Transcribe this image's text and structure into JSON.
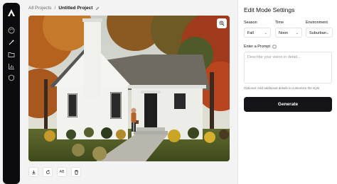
{
  "breadcrumb": {
    "root": "All Projects",
    "separator": "/",
    "current": "Untitled Project"
  },
  "sidebar": {
    "icons": [
      "logo-icon",
      "palette-icon",
      "magic-wand-icon",
      "folder-icon",
      "chart-icon",
      "shield-icon"
    ]
  },
  "toolbar": {
    "tools": [
      "download-icon",
      "rotate-icon",
      "compare-icon",
      "trash-icon"
    ],
    "compare_label": "AB"
  },
  "panel": {
    "title": "Edit Mode Settings",
    "season": {
      "label": "Season",
      "value": "Fall"
    },
    "time": {
      "label": "Time",
      "value": "Noon"
    },
    "environment": {
      "label": "Environment",
      "value": "Suburban"
    },
    "prompt": {
      "label": "Enter a Prompt",
      "placeholder": "Describe your vision in detail..."
    },
    "hint": "Optional: Add additional details to customize the style",
    "generate_label": "Generate"
  },
  "colors": {
    "accent": "#141418",
    "sidebar": "#0c0c0f"
  }
}
